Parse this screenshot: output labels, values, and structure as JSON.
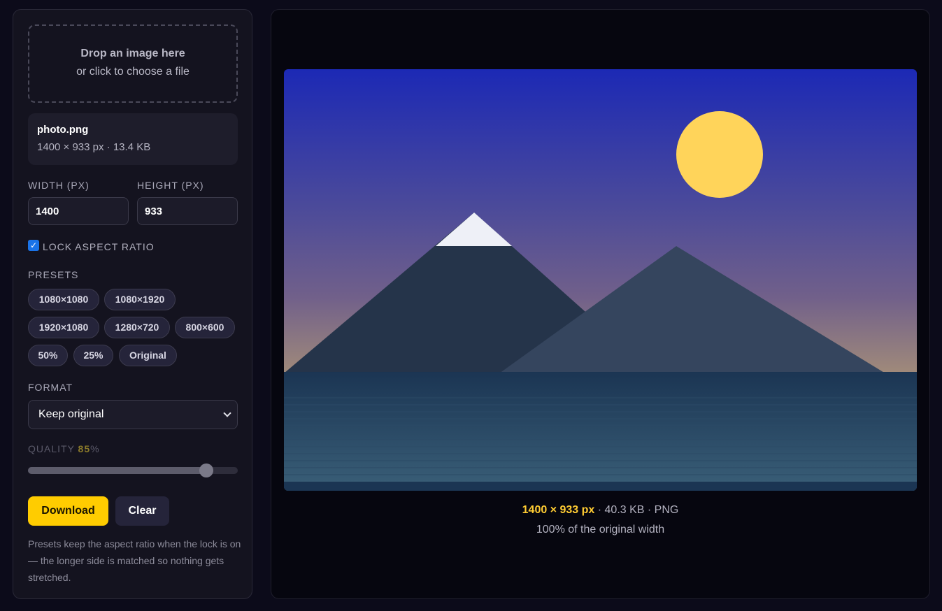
{
  "dropzone": {
    "title": "Drop an image here",
    "subtitle": "or click to choose a file"
  },
  "file": {
    "name": "photo.png",
    "meta": "1400 × 933 px · 13.4 KB"
  },
  "dimensions": {
    "width_label": "WIDTH (PX)",
    "width_value": "1400",
    "height_label": "HEIGHT (PX)",
    "height_value": "933"
  },
  "lock": {
    "label": "LOCK ASPECT RATIO",
    "checked": true
  },
  "presets": {
    "label": "PRESETS",
    "items": [
      "1080×1080",
      "1080×1920",
      "1920×1080",
      "1280×720",
      "800×600",
      "50%",
      "25%",
      "Original"
    ]
  },
  "format": {
    "label": "FORMAT",
    "selected": "Keep original"
  },
  "quality": {
    "label": "QUALITY",
    "value": "85",
    "unit": "%",
    "fraction": 0.85
  },
  "actions": {
    "download_label": "Download",
    "clear_label": "Clear"
  },
  "note": "Presets keep the aspect ratio when the lock is on — the longer side is matched so nothing gets stretched.",
  "output": {
    "dimensions": "1400 × 933 px",
    "details": " · 40.3 KB · PNG",
    "percent": "100% of the original width"
  },
  "colors": {
    "accent": "#ffcc00",
    "checkbox": "#1a73e8"
  }
}
